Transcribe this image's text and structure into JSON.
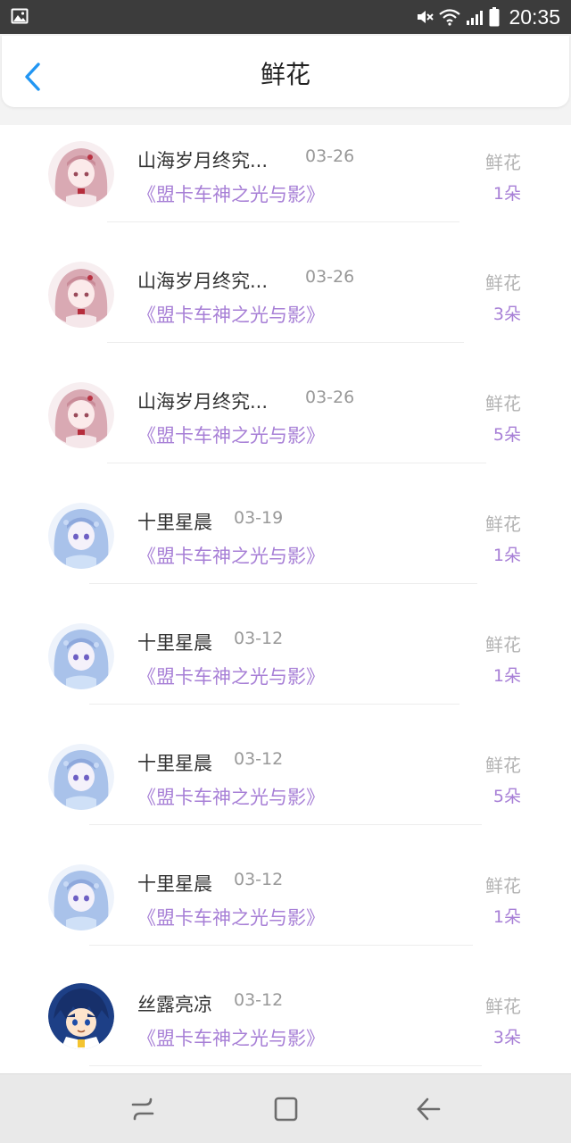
{
  "status_bar": {
    "time": "20:35",
    "icons": [
      "gallery-icon",
      "mute-icon",
      "wifi-icon",
      "signal-icon",
      "battery-icon"
    ]
  },
  "header": {
    "title": "鲜花",
    "back_icon": "chevron-left-icon"
  },
  "colors": {
    "accent": "#a77fd6",
    "back_arrow": "#2196f3"
  },
  "gifts": [
    {
      "name": "山海岁月终究...",
      "date": "03-26",
      "book": "《盟卡车神之光与影》",
      "gift": "鲜花",
      "count": "1朵",
      "avatar": "pink-hair-anime-avatar"
    },
    {
      "name": "山海岁月终究...",
      "date": "03-26",
      "book": "《盟卡车神之光与影》",
      "gift": "鲜花",
      "count": "3朵",
      "avatar": "pink-hair-anime-avatar"
    },
    {
      "name": "山海岁月终究...",
      "date": "03-26",
      "book": "《盟卡车神之光与影》",
      "gift": "鲜花",
      "count": "5朵",
      "avatar": "pink-hair-anime-avatar"
    },
    {
      "name": "十里星晨",
      "date": "03-19",
      "book": "《盟卡车神之光与影》",
      "gift": "鲜花",
      "count": "1朵",
      "avatar": "blue-hair-anime-avatar"
    },
    {
      "name": "十里星晨",
      "date": "03-12",
      "book": "《盟卡车神之光与影》",
      "gift": "鲜花",
      "count": "1朵",
      "avatar": "blue-hair-anime-avatar"
    },
    {
      "name": "十里星晨",
      "date": "03-12",
      "book": "《盟卡车神之光与影》",
      "gift": "鲜花",
      "count": "5朵",
      "avatar": "blue-hair-anime-avatar"
    },
    {
      "name": "十里星晨",
      "date": "03-12",
      "book": "《盟卡车神之光与影》",
      "gift": "鲜花",
      "count": "1朵",
      "avatar": "blue-hair-anime-avatar"
    },
    {
      "name": "丝露亮凉",
      "date": "03-12",
      "book": "《盟卡车神之光与影》",
      "gift": "鲜花",
      "count": "3朵",
      "avatar": "cartoon-boy-avatar"
    }
  ],
  "nav_bar": {
    "buttons": [
      "recent-apps-icon",
      "home-icon",
      "back-icon"
    ]
  }
}
